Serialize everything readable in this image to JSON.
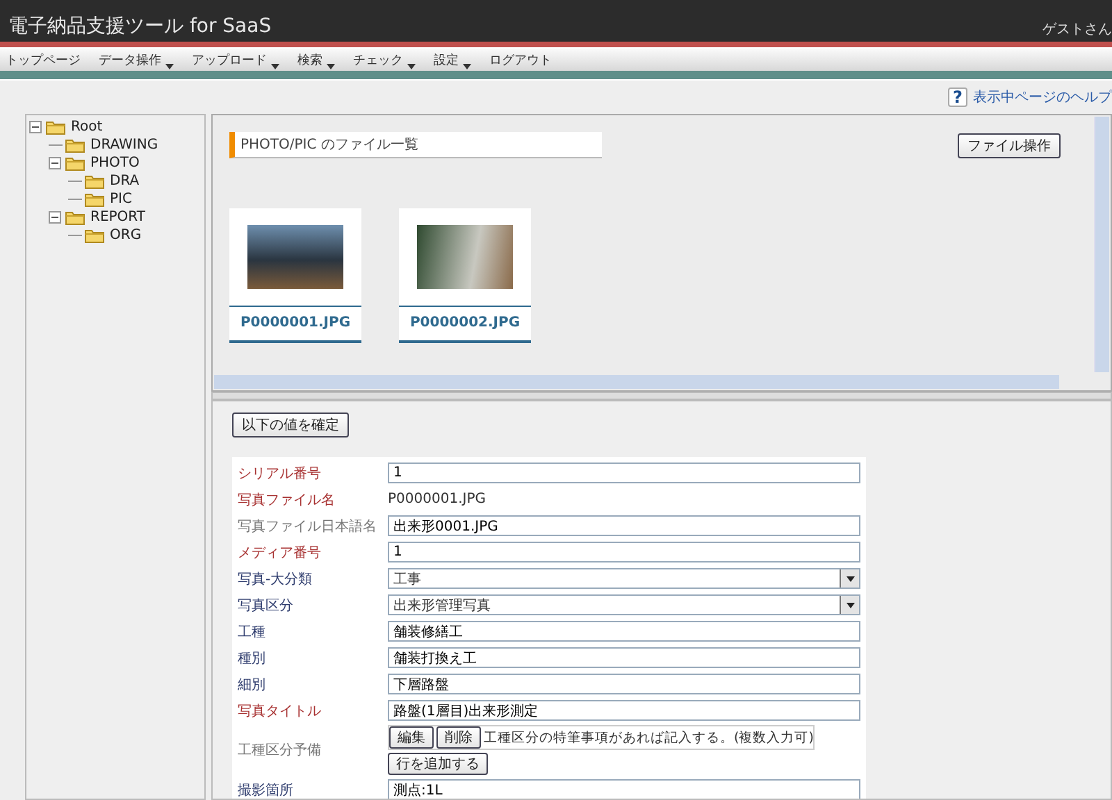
{
  "app": {
    "title": "電子納品支援ツール for SaaS",
    "user": "ゲストさん"
  },
  "menu": [
    {
      "label": "トップページ",
      "has_dropdown": false
    },
    {
      "label": "データ操作",
      "has_dropdown": true
    },
    {
      "label": "アップロード",
      "has_dropdown": true
    },
    {
      "label": "検索",
      "has_dropdown": true
    },
    {
      "label": "チェック",
      "has_dropdown": true
    },
    {
      "label": "設定",
      "has_dropdown": true
    },
    {
      "label": "ログアウト",
      "has_dropdown": false
    }
  ],
  "help_icon": "?",
  "help_link": "表示中ページのヘルプ",
  "tree": [
    {
      "label": "Root",
      "expanded": true,
      "children": [
        {
          "label": "DRAWING"
        },
        {
          "label": "PHOTO",
          "expanded": true,
          "children": [
            {
              "label": "DRA"
            },
            {
              "label": "PIC"
            }
          ]
        },
        {
          "label": "REPORT",
          "expanded": true,
          "children": [
            {
              "label": "ORG"
            }
          ]
        }
      ]
    }
  ],
  "file_list": {
    "heading": "PHOTO/PIC のファイル一覧",
    "action_button": "ファイル操作",
    "files": [
      {
        "name": "P0000001.JPG"
      },
      {
        "name": "P0000002.JPG"
      }
    ]
  },
  "confirm_button": "以下の値を確定",
  "form": [
    {
      "kind": "text",
      "label": "シリアル番号",
      "color": "#a83232",
      "value": "1"
    },
    {
      "kind": "static",
      "label": "写真ファイル名",
      "color": "#a83232",
      "value": "P0000001.JPG"
    },
    {
      "kind": "text",
      "label": "写真ファイル日本語名",
      "color": "#777777",
      "value": "出来形0001.JPG"
    },
    {
      "kind": "text",
      "label": "メディア番号",
      "color": "#a83232",
      "value": "1"
    },
    {
      "kind": "select",
      "label": "写真-大分類",
      "color": "#2c3a6c",
      "value": "工事"
    },
    {
      "kind": "select",
      "label": "写真区分",
      "color": "#2c3a6c",
      "value": "出来形管理写真"
    },
    {
      "kind": "text",
      "label": "工種",
      "color": "#2c3a6c",
      "value": "舗装修繕工"
    },
    {
      "kind": "text",
      "label": "種別",
      "color": "#2c3a6c",
      "value": "舗装打換え工"
    },
    {
      "kind": "text",
      "label": "細別",
      "color": "#2c3a6c",
      "value": "下層路盤"
    },
    {
      "kind": "text",
      "label": "写真タイトル",
      "color": "#a83232",
      "value": "路盤(1層目)出来形測定"
    },
    {
      "kind": "memo",
      "label": "工種区分予備",
      "color": "#777777",
      "edit_button": "編集",
      "delete_button": "削除",
      "value": "工種区分の特筆事項があれば記入する。(複数入力可)",
      "add_button": "行を追加する"
    },
    {
      "kind": "text",
      "label": "撮影箇所",
      "color": "#2c3a6c",
      "value": "測点:1L"
    }
  ]
}
